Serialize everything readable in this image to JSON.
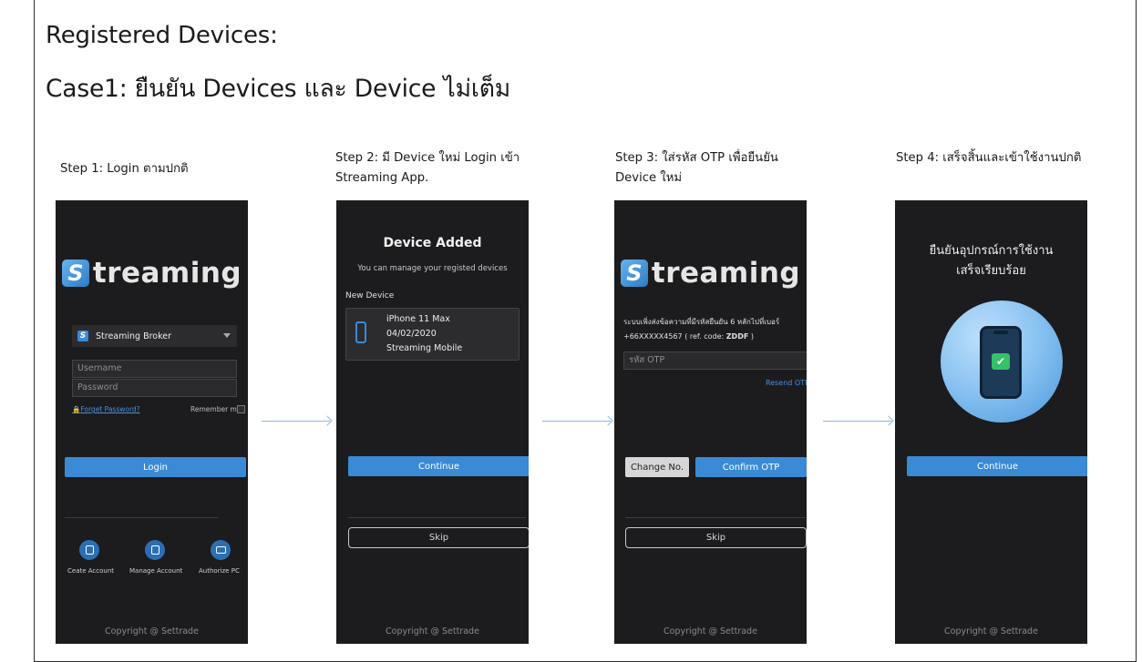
{
  "heading": "Registered Devices:",
  "case_title": "Case1: ยืนยัน Devices และ Device ไม่เต็ม",
  "steps": [
    {
      "title_line1": "Step 1: Login ตามปกติ",
      "title_line2": ""
    },
    {
      "title_line1": "Step 2: มี Device ใหม่ Login  เข้า",
      "title_line2": "Streaming App."
    },
    {
      "title_line1": "Step 3: ใส่รหัส OTP เพื่อยืนยัน",
      "title_line2": "Device ใหม่"
    },
    {
      "title_line1": "Step 4: เสร็จสิ้นและเข้าใช้งานปกติ",
      "title_line2": ""
    }
  ],
  "logo": {
    "letter": "S",
    "word": "treaming"
  },
  "screen1": {
    "broker": "Streaming Broker",
    "username_placeholder": "Username",
    "password_placeholder": "Password",
    "forget_password": "Forget Password?",
    "remember_me": "Remember me",
    "login": "Login",
    "create_account": "Ceate Account",
    "manage_account": "Manage Account",
    "authorize_pc": "Authorize PC",
    "copyright": "Copyright @ Settrade"
  },
  "screen2": {
    "title": "Device Added",
    "subtitle": "You can manage your registed devices",
    "new_device_label": "New Device",
    "device_name": "iPhone 11 Max",
    "device_date": "04/02/2020",
    "device_app": "Streaming Mobile",
    "continue": "Continue",
    "skip": "Skip",
    "copyright": "Copyright @ Settrade"
  },
  "screen3": {
    "message_line1": "ระบบเพิ่งส่งข้อความที่มีรหัสยืนยัน 6 หลักไปที่เบอร์",
    "message_line2_prefix": "+66XXXXX4567 ( ref. code: ",
    "ref_code": "ZDDF",
    "message_line2_suffix": " )",
    "otp_placeholder": "รหัส OTP",
    "resend": "Resend OTP",
    "change_no": "Change No.",
    "confirm_otp": "Confirm OTP",
    "skip": "Skip",
    "copyright": "Copyright @ Settrade"
  },
  "screen4": {
    "title_line1": "ยืนยันอุปกรณ์การใช้งาน",
    "title_line2": "เสร็จเรียบร้อย",
    "check_mark": "✔",
    "continue": "Continue",
    "copyright": "Copyright @ Settrade"
  },
  "colors": {
    "accent": "#3a8ad6",
    "screen_bg": "#1c1c1e",
    "arrow": "#8ab8e6"
  }
}
